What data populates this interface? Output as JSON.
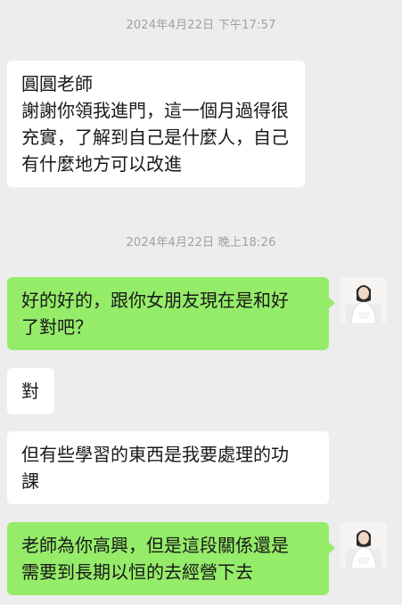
{
  "timestamps": [
    "2024年4月22日 下午17:57",
    "2024年4月22日 晚上18:26"
  ],
  "messages": [
    {
      "side": "left",
      "lines": [
        "圓圓老師",
        "謝謝你領我進門，這一個月過得很",
        "充實，了解到自己是什麼人，自己",
        "有什麼地方可以改進"
      ]
    },
    {
      "side": "right",
      "lines": [
        "好的好的，跟你女朋友現在是和好",
        "了對吧？"
      ],
      "avatar": "teacher-avatar"
    },
    {
      "side": "left",
      "lines": [
        "對"
      ]
    },
    {
      "side": "left",
      "lines": [
        "但有些學習的東西是我要處理的功",
        "課"
      ]
    },
    {
      "side": "right",
      "lines": [
        "老師為你高興，但是這段關係還是",
        "需要到長期以恒的去經營下去"
      ],
      "avatar": "teacher-avatar"
    }
  ],
  "colors": {
    "background": "#ededed",
    "sent_bubble": "#95ec69",
    "received_bubble": "#ffffff",
    "timestamp_text": "#a0a0a0"
  }
}
